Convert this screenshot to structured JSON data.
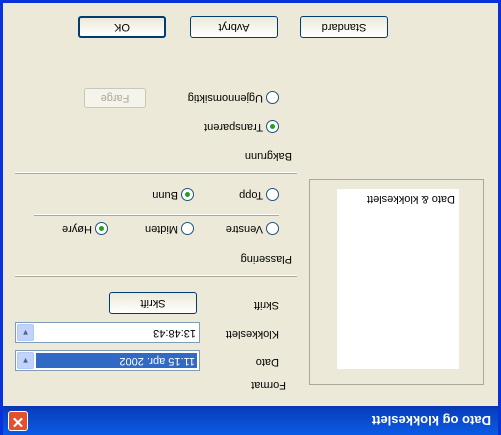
{
  "window": {
    "title": "Dato og klokkeslett",
    "close_glyph": "✕"
  },
  "format_section": {
    "heading": "Format",
    "date_label": "Dato",
    "date_value": "11.15 apr. 2002",
    "time_label": "Klokkeslett",
    "time_value": "13:48:43",
    "font_label": "Skrift",
    "font_button": "Skrift"
  },
  "position_section": {
    "heading": "Plassering",
    "horizontal": [
      {
        "label": "Venstre",
        "selected": false
      },
      {
        "label": "Midten",
        "selected": false
      },
      {
        "label": "Høyre",
        "selected": true
      }
    ],
    "vertical": [
      {
        "label": "Topp",
        "selected": false
      },
      {
        "label": "Bunn",
        "selected": true
      }
    ]
  },
  "background_section": {
    "heading": "Bakgrunn",
    "options": [
      {
        "label": "Transparent",
        "selected": true
      },
      {
        "label": "Ugjennomsiktig",
        "selected": false
      }
    ],
    "color_button": "Farge"
  },
  "preview": {
    "text": "Dato & klokkeslett"
  },
  "buttons": {
    "ok": "OK",
    "cancel": "Avbryt",
    "default": "Standard"
  },
  "icons": {
    "close": "close-icon",
    "dropdown": "chevron-down-icon"
  },
  "colors": {
    "titlebar": "#0b4fd2",
    "face": "#ece9d8",
    "selection": "#316ac5",
    "close": "#e0512c"
  }
}
